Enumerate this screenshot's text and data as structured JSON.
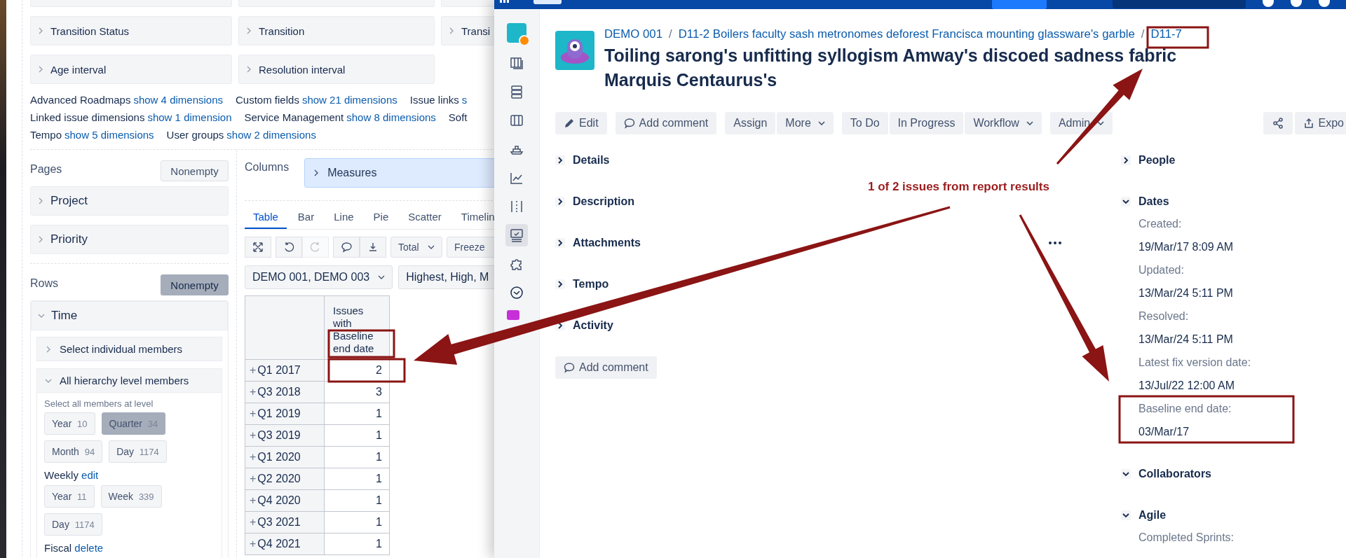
{
  "dimensions": {
    "rows": [
      [
        "Transition Status",
        "Transition",
        "Transi"
      ],
      [
        "Age interval",
        "Resolution interval"
      ]
    ],
    "groups": [
      [
        {
          "name": "Advanced Roadmaps",
          "link": "show 4 dimensions"
        },
        {
          "name": "Custom fields",
          "link": "show 21 dimensions"
        },
        {
          "name": "Issue links",
          "link": "s"
        }
      ],
      [
        {
          "name": "Linked issue dimensions",
          "link": "show 1 dimension"
        },
        {
          "name": "Service Management",
          "link": "show 8 dimensions"
        },
        {
          "name": "Soft"
        }
      ],
      [
        {
          "name": "Tempo",
          "link": "show 5 dimensions"
        },
        {
          "name": "User groups",
          "link": "show 2 dimensions"
        }
      ]
    ]
  },
  "pages": {
    "title": "Pages",
    "nonempty": {
      "label": "Nonempty",
      "selected": false
    },
    "items": [
      {
        "label": "Project",
        "expanded": false
      },
      {
        "label": "Priority",
        "expanded": false
      }
    ]
  },
  "rows": {
    "title": "Rows",
    "nonempty": {
      "label": "Nonempty",
      "selected": true
    },
    "dimension": {
      "label": "Time",
      "expanded": true
    },
    "options": [
      {
        "label": "Select individual members",
        "expanded": false
      },
      {
        "label": "All hierarchy level members",
        "expanded": true
      }
    ],
    "hint": "Select all members at level",
    "levels": [
      {
        "chips": [
          {
            "label": "Year",
            "count": "10",
            "selected": false
          },
          {
            "label": "Quarter",
            "count": "34",
            "selected": true
          },
          {
            "label": "Month",
            "count": "94",
            "selected": false
          },
          {
            "label": "Day",
            "count": "1174",
            "selected": false
          }
        ]
      },
      {
        "title": "Weekly",
        "action": "edit",
        "chips": [
          {
            "label": "Year",
            "count": "11",
            "selected": false
          },
          {
            "label": "Week",
            "count": "339",
            "selected": false
          },
          {
            "label": "Day",
            "count": "1174",
            "selected": false
          }
        ]
      },
      {
        "title": "Fiscal",
        "action": "delete"
      }
    ]
  },
  "columns": {
    "title": "Columns",
    "items": [
      {
        "label": "Measures",
        "expanded": false
      }
    ]
  },
  "view_tabs": [
    {
      "label": "Table",
      "selected": true
    },
    {
      "label": "Bar",
      "selected": false
    },
    {
      "label": "Line",
      "selected": false
    },
    {
      "label": "Pie",
      "selected": false
    },
    {
      "label": "Scatter",
      "selected": false
    },
    {
      "label": "Timelin",
      "selected": false
    }
  ],
  "tool_groups": [
    [
      {
        "kind": "fullscreen",
        "disabled": false
      }
    ],
    [
      {
        "kind": "undo",
        "disabled": false
      },
      {
        "kind": "redo",
        "disabled": true
      }
    ],
    [
      {
        "kind": "comment",
        "disabled": false
      },
      {
        "kind": "download",
        "disabled": false
      }
    ]
  ],
  "dropdowns": [
    {
      "label": "Total",
      "caret": true
    },
    {
      "label": "Freeze",
      "caret": false
    }
  ],
  "filters": [
    {
      "label": "DEMO 001, DEMO 003",
      "caret": true
    },
    {
      "label": "Highest, High, M",
      "caret": false
    }
  ],
  "table": {
    "column": "Issues with Baseline end date",
    "rows": [
      {
        "expander": "+",
        "label": "Q1 2017",
        "value": "2"
      },
      {
        "expander": "+",
        "label": "Q3 2018",
        "value": "3"
      },
      {
        "expander": "+",
        "label": "Q1 2019",
        "value": "1"
      },
      {
        "expander": "+",
        "label": "Q3 2019",
        "value": "1"
      },
      {
        "expander": "+",
        "label": "Q1 2020",
        "value": "1"
      },
      {
        "expander": "+",
        "label": "Q2 2020",
        "value": "1"
      },
      {
        "expander": "+",
        "label": "Q4 2020",
        "value": "1"
      },
      {
        "expander": "+",
        "label": "Q3 2021",
        "value": "1"
      },
      {
        "expander": "+",
        "label": "Q4 2021",
        "value": "1"
      }
    ]
  },
  "jira": {
    "sidebar": [
      {
        "kind": "board",
        "selected": false
      },
      {
        "kind": "backlog",
        "selected": false
      },
      {
        "kind": "columns",
        "selected": false
      },
      {
        "kind": "ship",
        "selected": false
      },
      {
        "kind": "chart",
        "selected": false
      },
      {
        "kind": "dotted",
        "selected": false
      },
      {
        "kind": "monitor",
        "selected": true
      },
      {
        "kind": "puzzle",
        "selected": false
      },
      {
        "kind": "clock",
        "selected": false
      }
    ],
    "breadcrumbs": [
      {
        "kind": "link",
        "text": "DEMO 001"
      },
      {
        "kind": "separator",
        "text": "/"
      },
      {
        "kind": "link",
        "text": "D11-2 Boilers faculty sash metronomes deforest Francisca mounting glassware's garble"
      },
      {
        "kind": "separator",
        "text": "/"
      },
      {
        "kind": "link",
        "text": "D11-7"
      }
    ],
    "title": "Toiling sarong's unfitting syllogism Amway's discoed sadness fabric Marquis Centaurus's",
    "action_groups": [
      [
        {
          "label": "Edit",
          "kind": "edit"
        }
      ],
      [
        {
          "label": "Add comment",
          "kind": "comment"
        }
      ],
      [
        {
          "label": "Assign",
          "kind": "plain"
        },
        {
          "label": "More",
          "kind": "menu"
        }
      ],
      [
        {
          "label": "To Do",
          "kind": "plain"
        },
        {
          "label": "In Progress",
          "kind": "plain"
        },
        {
          "label": "Workflow",
          "kind": "menu"
        }
      ],
      [
        {
          "label": "Admin",
          "kind": "menu"
        }
      ]
    ],
    "export": "Expo",
    "sections": [
      {
        "label": "Details",
        "expanded": false
      },
      {
        "label": "Description",
        "expanded": false
      },
      {
        "label": "Attachments",
        "expanded": false,
        "more": true
      },
      {
        "label": "Tempo",
        "expanded": false
      },
      {
        "label": "Activity",
        "expanded": false
      }
    ],
    "comment_button": "Add comment",
    "side_sections": [
      {
        "label": "People",
        "expanded": false
      },
      {
        "label": "Dates",
        "expanded": true,
        "fields": [
          {
            "label": "Created:",
            "value": "19/Mar/17 8:09 AM"
          },
          {
            "label": "Updated:",
            "value": "13/Mar/24 5:11 PM"
          },
          {
            "label": "Resolved:",
            "value": "13/Mar/24 5:11 PM"
          },
          {
            "label": "Latest fix version date:",
            "value": "13/Jul/22 12:00 AM"
          },
          {
            "label": "Baseline end date:",
            "value": "03/Mar/17"
          }
        ]
      },
      {
        "label": "Collaborators",
        "expanded": true
      },
      {
        "label": "Agile",
        "expanded": true,
        "fields": [
          {
            "label": "Completed Sprints:"
          }
        ]
      }
    ]
  },
  "annotation": "1 of 2 issues from report results"
}
